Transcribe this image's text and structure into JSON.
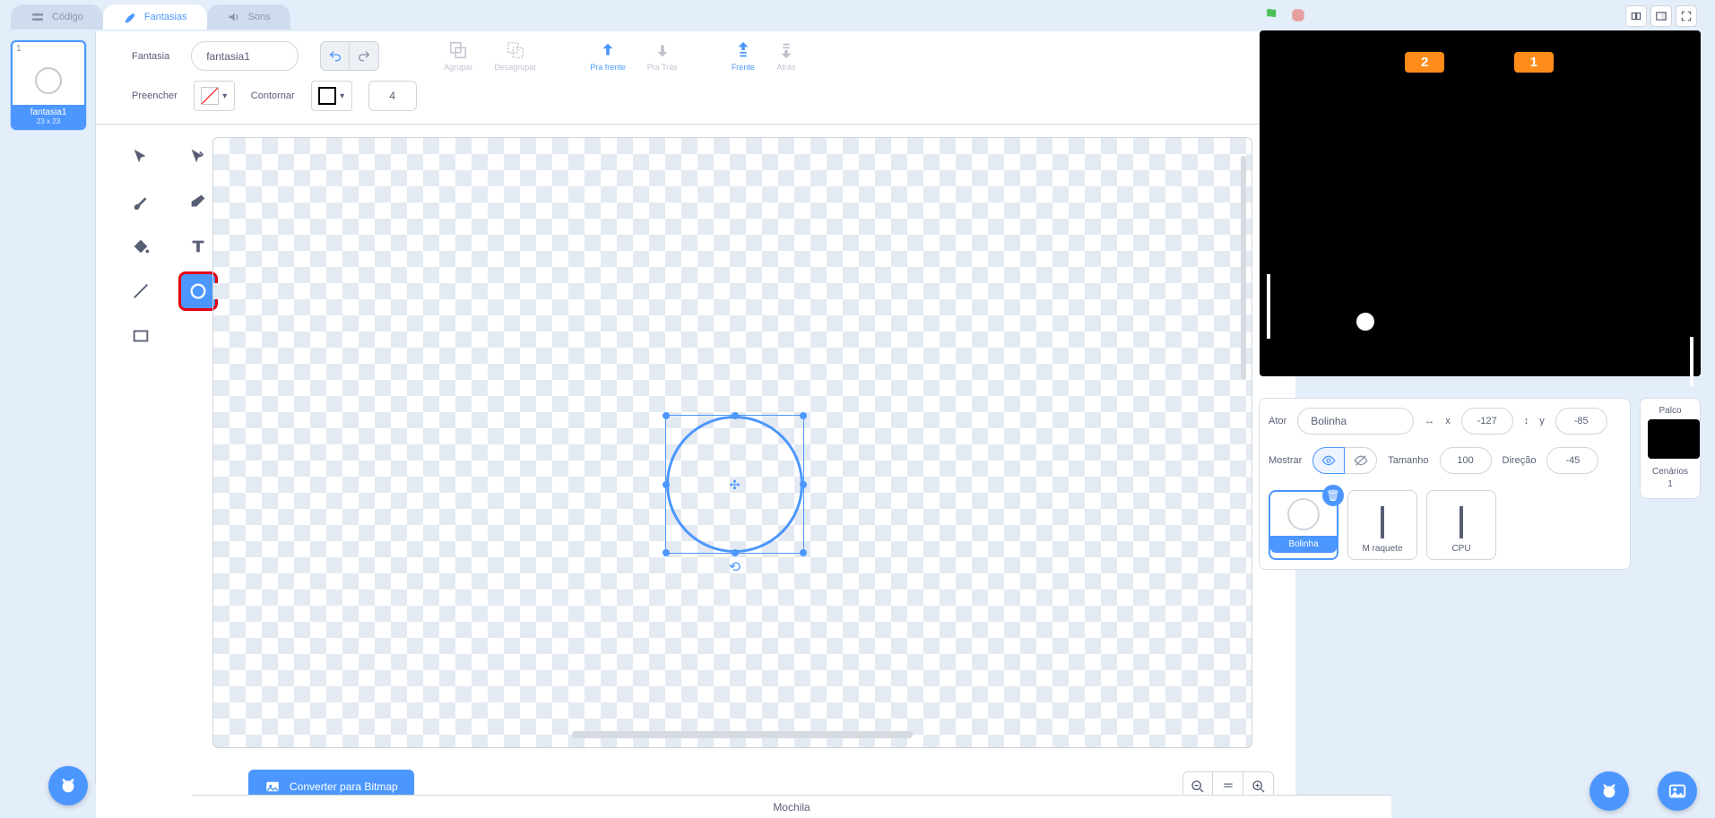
{
  "tabs": {
    "code": "Código",
    "costumes": "Fantasias",
    "sounds": "Sons"
  },
  "costume_thumb": {
    "index": "1",
    "name": "fantasia1",
    "dim": "23 x 23"
  },
  "toolbar": {
    "costume_label": "Fantasia",
    "costume_name": "fantasia1",
    "group": "Agrupar",
    "ungroup": "Desagrupar",
    "forward": "Pra frente",
    "backward": "Pra Trás",
    "front": "Frente",
    "back": "Atrás",
    "fill_label": "Preencher",
    "outline_label": "Contornar",
    "outline_width": "4"
  },
  "convert_btn": "Converter para Bitmap",
  "stage": {
    "score_left": "2",
    "score_right": "1"
  },
  "sprite_info": {
    "sprite_label": "Ator",
    "sprite_name": "Bolinha",
    "x_label": "x",
    "x_value": "-127",
    "y_label": "y",
    "y_value": "-85",
    "show_label": "Mostrar",
    "size_label": "Tamanho",
    "size_value": "100",
    "direction_label": "Direção",
    "direction_value": "-45"
  },
  "sprites": {
    "s1": "Bolinha",
    "s2": "M raquete",
    "s3": "CPU"
  },
  "stage_pane": {
    "title": "Palco",
    "sub": "Cenários",
    "count": "1"
  },
  "backpack": "Mochila"
}
